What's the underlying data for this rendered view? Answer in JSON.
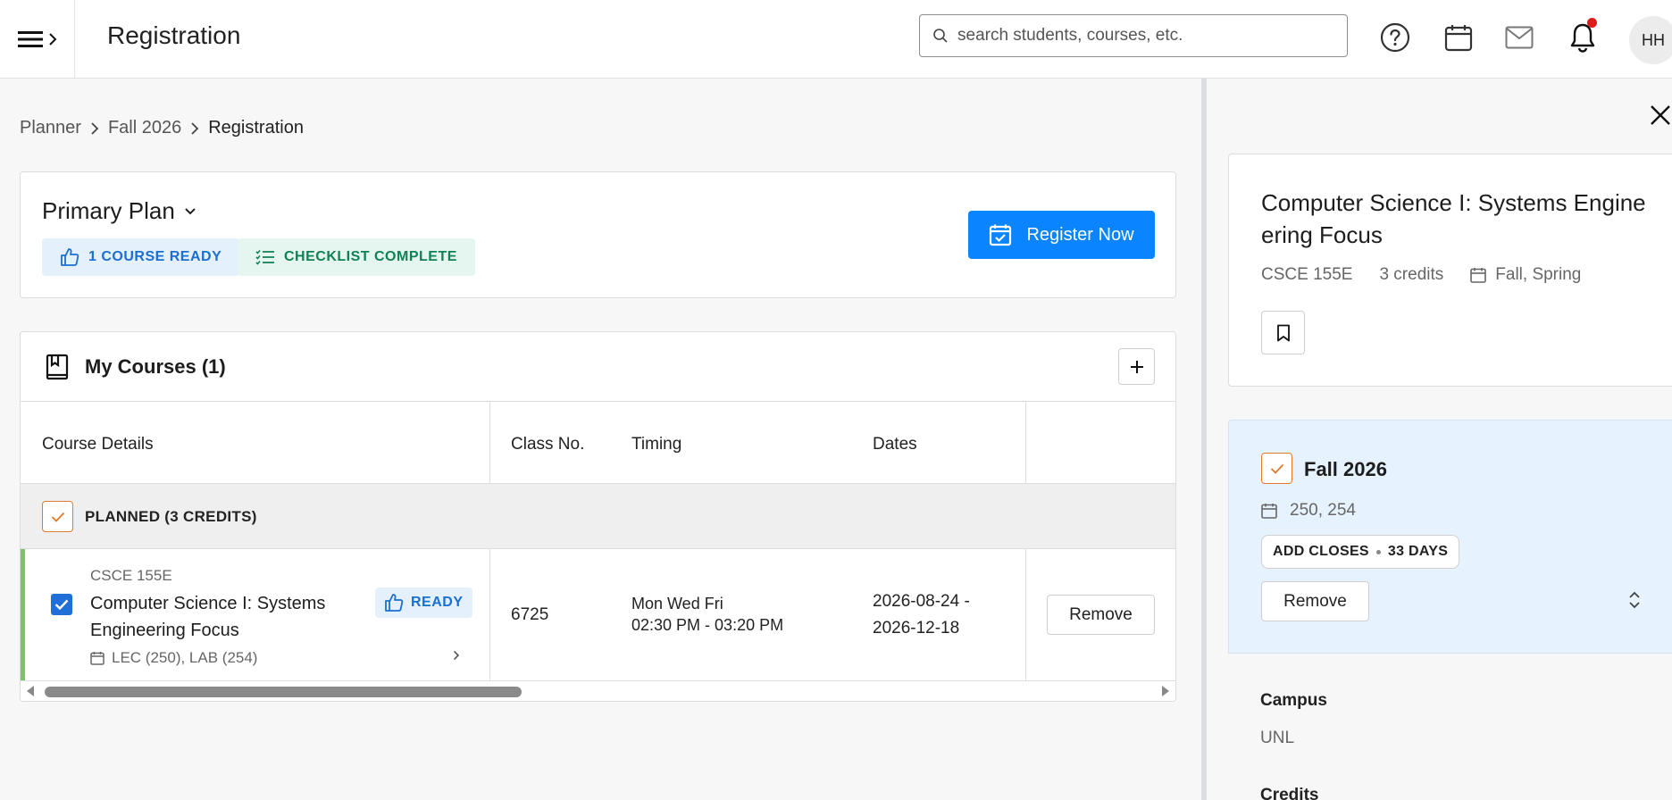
{
  "header": {
    "title": "Registration",
    "search_placeholder": "search students, courses, etc.",
    "avatar_initials": "HH",
    "notification_dot_color": "#e01b1b"
  },
  "breadcrumb": [
    "Planner",
    "Fall 2026",
    "Registration"
  ],
  "plan": {
    "title": "Primary Plan",
    "badges": {
      "ready": "1 COURSE READY",
      "checklist": "CHECKLIST COMPLETE"
    },
    "register_label": "Register Now",
    "accent_color": "#0a84ff"
  },
  "courses": {
    "title": "My Courses (1)",
    "columns": {
      "details": "Course Details",
      "class_no": "Class No.",
      "timing": "Timing",
      "dates": "Dates"
    },
    "group_label": "PLANNED (3 CREDITS)",
    "rows": [
      {
        "code": "CSCE 155E",
        "name": "Computer Science I: Systems Engineering Focus",
        "sections": "LEC (250), LAB (254)",
        "status": "READY",
        "class_no": "6725",
        "days": "Mon Wed Fri",
        "time": "02:30 PM - 03:20 PM",
        "date_start": "2026-08-24 -",
        "date_end": "2026-12-18",
        "remove_label": "Remove"
      }
    ]
  },
  "detail": {
    "title": "Computer Science I: Systems Engineering Focus",
    "code": "CSCE 155E",
    "credits": "3 credits",
    "terms": "Fall, Spring",
    "term": {
      "name": "Fall 2026",
      "sections": "250, 254",
      "add_closes_label": "ADD CLOSES",
      "add_closes_value": "33 DAYS",
      "remove_label": "Remove"
    },
    "campus_label": "Campus",
    "campus_value": "UNL",
    "credits_label": "Credits"
  }
}
